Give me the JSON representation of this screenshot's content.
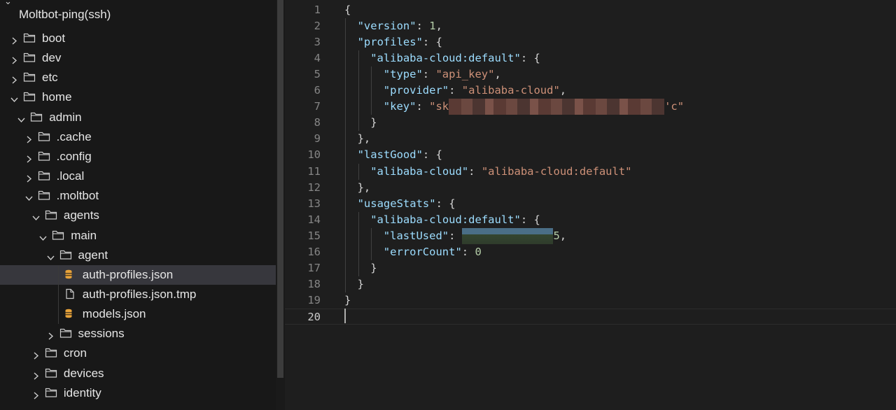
{
  "explorer": {
    "root_title": "Moltbot-ping(ssh)",
    "items": [
      {
        "label": "boot",
        "kind": "folder",
        "open": false,
        "depth": 0,
        "icon": "folder-icon"
      },
      {
        "label": "dev",
        "kind": "folder",
        "open": false,
        "depth": 0,
        "icon": "folder-icon"
      },
      {
        "label": "etc",
        "kind": "folder",
        "open": false,
        "depth": 0,
        "icon": "folder-icon"
      },
      {
        "label": "home",
        "kind": "folder",
        "open": true,
        "depth": 0,
        "icon": "folder-icon"
      },
      {
        "label": "admin",
        "kind": "folder",
        "open": true,
        "depth": 1,
        "icon": "folder-icon"
      },
      {
        "label": ".cache",
        "kind": "folder",
        "open": false,
        "depth": 2,
        "icon": "folder-icon"
      },
      {
        "label": ".config",
        "kind": "folder",
        "open": false,
        "depth": 2,
        "icon": "folder-icon"
      },
      {
        "label": ".local",
        "kind": "folder",
        "open": false,
        "depth": 2,
        "icon": "folder-icon"
      },
      {
        "label": ".moltbot",
        "kind": "folder",
        "open": true,
        "depth": 2,
        "icon": "folder-icon"
      },
      {
        "label": "agents",
        "kind": "folder",
        "open": true,
        "depth": 3,
        "icon": "folder-icon"
      },
      {
        "label": "main",
        "kind": "folder",
        "open": true,
        "depth": 4,
        "icon": "folder-icon"
      },
      {
        "label": "agent",
        "kind": "folder",
        "open": true,
        "depth": 5,
        "icon": "folder-icon"
      },
      {
        "label": "auth-profiles.json",
        "kind": "json",
        "depth": 6,
        "selected": true,
        "icon": "json-database-icon"
      },
      {
        "label": "auth-profiles.json.tmp",
        "kind": "file",
        "depth": 6,
        "icon": "file-icon"
      },
      {
        "label": "models.json",
        "kind": "json",
        "depth": 6,
        "icon": "json-database-icon"
      },
      {
        "label": "sessions",
        "kind": "folder",
        "open": false,
        "depth": 5,
        "icon": "folder-icon"
      },
      {
        "label": "cron",
        "kind": "folder",
        "open": false,
        "depth": 3,
        "icon": "folder-icon"
      },
      {
        "label": "devices",
        "kind": "folder",
        "open": false,
        "depth": 3,
        "icon": "folder-icon"
      },
      {
        "label": "identity",
        "kind": "folder",
        "open": false,
        "depth": 3,
        "icon": "folder-icon"
      }
    ]
  },
  "editor": {
    "current_line": 20,
    "lines": [
      [
        {
          "t": "p",
          "v": "{"
        }
      ],
      [
        {
          "t": "k",
          "v": "\"version\""
        },
        {
          "t": "p",
          "v": ": "
        },
        {
          "t": "n",
          "v": "1"
        },
        {
          "t": "p",
          "v": ","
        }
      ],
      [
        {
          "t": "k",
          "v": "\"profiles\""
        },
        {
          "t": "p",
          "v": ": {"
        }
      ],
      [
        {
          "t": "k",
          "v": "\"alibaba-cloud:default\""
        },
        {
          "t": "p",
          "v": ": {"
        }
      ],
      [
        {
          "t": "k",
          "v": "\"type\""
        },
        {
          "t": "p",
          "v": ": "
        },
        {
          "t": "s",
          "v": "\"api_key\""
        },
        {
          "t": "p",
          "v": ","
        }
      ],
      [
        {
          "t": "k",
          "v": "\"provider\""
        },
        {
          "t": "p",
          "v": ": "
        },
        {
          "t": "s",
          "v": "\"alibaba-cloud\""
        },
        {
          "t": "p",
          "v": ","
        }
      ],
      [
        {
          "t": "k",
          "v": "\"key\""
        },
        {
          "t": "p",
          "v": ": "
        },
        {
          "t": "s",
          "v": "\"sk"
        },
        {
          "t": "redact",
          "v": "                                 "
        },
        {
          "t": "s",
          "v": "'c\""
        }
      ],
      [
        {
          "t": "p",
          "v": "}"
        }
      ],
      [
        {
          "t": "p",
          "v": "},"
        }
      ],
      [
        {
          "t": "k",
          "v": "\"lastGood\""
        },
        {
          "t": "p",
          "v": ": {"
        }
      ],
      [
        {
          "t": "k",
          "v": "\"alibaba-cloud\""
        },
        {
          "t": "p",
          "v": ": "
        },
        {
          "t": "s",
          "v": "\"alibaba-cloud:default\""
        }
      ],
      [
        {
          "t": "p",
          "v": "},"
        }
      ],
      [
        {
          "t": "k",
          "v": "\"usageStats\""
        },
        {
          "t": "p",
          "v": ": {"
        }
      ],
      [
        {
          "t": "k",
          "v": "\"alibaba-cloud:default\""
        },
        {
          "t": "p",
          "v": ": {"
        }
      ],
      [
        {
          "t": "k",
          "v": "\"lastUsed\""
        },
        {
          "t": "p",
          "v": ": "
        },
        {
          "t": "redact2",
          "v": "              "
        },
        {
          "t": "n",
          "v": "5"
        },
        {
          "t": "p",
          "v": ","
        }
      ],
      [
        {
          "t": "k",
          "v": "\"errorCount\""
        },
        {
          "t": "p",
          "v": ": "
        },
        {
          "t": "n",
          "v": "0"
        }
      ],
      [
        {
          "t": "p",
          "v": "}"
        }
      ],
      [
        {
          "t": "p",
          "v": "}"
        }
      ],
      [
        {
          "t": "p",
          "v": "}"
        }
      ],
      []
    ],
    "indents": [
      0,
      1,
      1,
      2,
      3,
      3,
      3,
      2,
      1,
      1,
      2,
      1,
      1,
      2,
      3,
      3,
      2,
      1,
      0,
      0
    ]
  },
  "colors": {
    "folder": "#cccccc",
    "json_icon": "#e8a33a",
    "keyword": "#9cdcfe",
    "string": "#ce9178",
    "number": "#b5cea8"
  }
}
